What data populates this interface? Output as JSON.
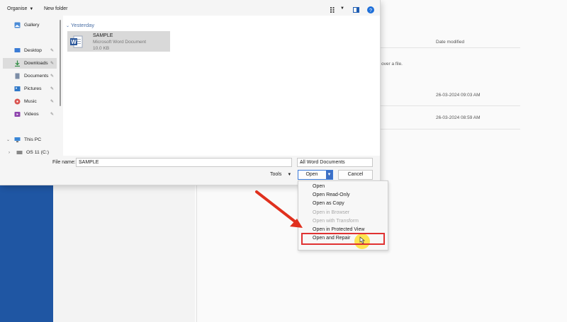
{
  "toolbar": {
    "organise": "Organise",
    "new_folder": "New folder"
  },
  "nav": [
    {
      "label": "Gallery",
      "icon": "gallery-icon",
      "pinned": false,
      "selected": false
    },
    {
      "label": "Desktop",
      "icon": "desktop-icon",
      "pinned": true,
      "selected": false
    },
    {
      "label": "Downloads",
      "icon": "downloads-icon",
      "pinned": true,
      "selected": true
    },
    {
      "label": "Documents",
      "icon": "documents-icon",
      "pinned": true,
      "selected": false
    },
    {
      "label": "Pictures",
      "icon": "pictures-icon",
      "pinned": true,
      "selected": false
    },
    {
      "label": "Music",
      "icon": "music-icon",
      "pinned": true,
      "selected": false
    },
    {
      "label": "Videos",
      "icon": "videos-icon",
      "pinned": true,
      "selected": false
    },
    {
      "label": "This PC",
      "icon": "pc-icon",
      "pinned": false,
      "selected": false
    },
    {
      "label": "OS 11 (C:)",
      "icon": "drive-icon",
      "pinned": false,
      "selected": false
    }
  ],
  "files": {
    "group": "Yesterday",
    "items": [
      {
        "name": "SAMPLE",
        "type": "Microsoft Word Document",
        "size": "10.0 KB"
      }
    ]
  },
  "bottom": {
    "file_name_label": "File name:",
    "file_name_value": "SAMPLE",
    "filter": "All Word Documents",
    "tools": "Tools",
    "open": "Open",
    "cancel": "Cancel"
  },
  "menu": [
    {
      "label": "Open",
      "disabled": false
    },
    {
      "label": "Open Read-Only",
      "disabled": false
    },
    {
      "label": "Open as Copy",
      "disabled": false
    },
    {
      "label": "Open in Browser",
      "disabled": true
    },
    {
      "label": "Open with Transform",
      "disabled": true
    },
    {
      "label": "Open in Protected View",
      "disabled": false
    },
    {
      "label": "Open and Repair",
      "disabled": false
    }
  ],
  "background": {
    "date_modified": "Date modified",
    "hover_hint": "over a file.",
    "dates": [
      "26-03-2024 09:03 AM",
      "26-03-2024 08:59 AM"
    ]
  },
  "colors": {
    "highlight": "#e03131",
    "arrow": "#e0301e",
    "word_blue": "#2b579a"
  }
}
